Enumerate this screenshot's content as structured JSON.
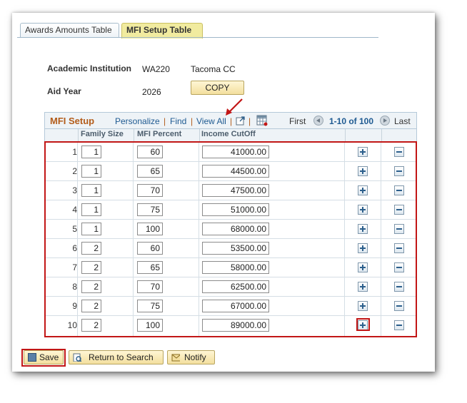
{
  "tabs": [
    {
      "label": "Awards Amounts Table",
      "active": false
    },
    {
      "label": "MFI Setup Table",
      "active": true
    }
  ],
  "info": {
    "institution_label": "Academic Institution",
    "institution_code": "WA220",
    "institution_name": "Tacoma CC",
    "aid_year_label": "Aid Year",
    "aid_year": "2026",
    "copy_button": "COPY"
  },
  "grid": {
    "title": "MFI Setup",
    "personalize": "Personalize",
    "find": "Find",
    "view_all": "View All",
    "first": "First",
    "range": "1-10 of 100",
    "last": "Last",
    "columns": [
      "Family Size",
      "MFI Percent",
      "Income CutOff"
    ],
    "rows": [
      {
        "num": "1",
        "family_size": "1",
        "mfi_percent": "60",
        "income_cutoff": "41000.00"
      },
      {
        "num": "2",
        "family_size": "1",
        "mfi_percent": "65",
        "income_cutoff": "44500.00"
      },
      {
        "num": "3",
        "family_size": "1",
        "mfi_percent": "70",
        "income_cutoff": "47500.00"
      },
      {
        "num": "4",
        "family_size": "1",
        "mfi_percent": "75",
        "income_cutoff": "51000.00"
      },
      {
        "num": "5",
        "family_size": "1",
        "mfi_percent": "100",
        "income_cutoff": "68000.00"
      },
      {
        "num": "6",
        "family_size": "2",
        "mfi_percent": "60",
        "income_cutoff": "53500.00"
      },
      {
        "num": "7",
        "family_size": "2",
        "mfi_percent": "65",
        "income_cutoff": "58000.00"
      },
      {
        "num": "8",
        "family_size": "2",
        "mfi_percent": "70",
        "income_cutoff": "62500.00"
      },
      {
        "num": "9",
        "family_size": "2",
        "mfi_percent": "75",
        "income_cutoff": "67000.00"
      },
      {
        "num": "10",
        "family_size": "2",
        "mfi_percent": "100",
        "income_cutoff": "89000.00"
      }
    ]
  },
  "buttons": {
    "save": "Save",
    "return_to_search": "Return to Search",
    "notify": "Notify"
  },
  "colors": {
    "highlight": "#c21616",
    "title_orange": "#b35c1a",
    "link_blue": "#1e5a91",
    "active_tab": "#f1eb9f"
  }
}
